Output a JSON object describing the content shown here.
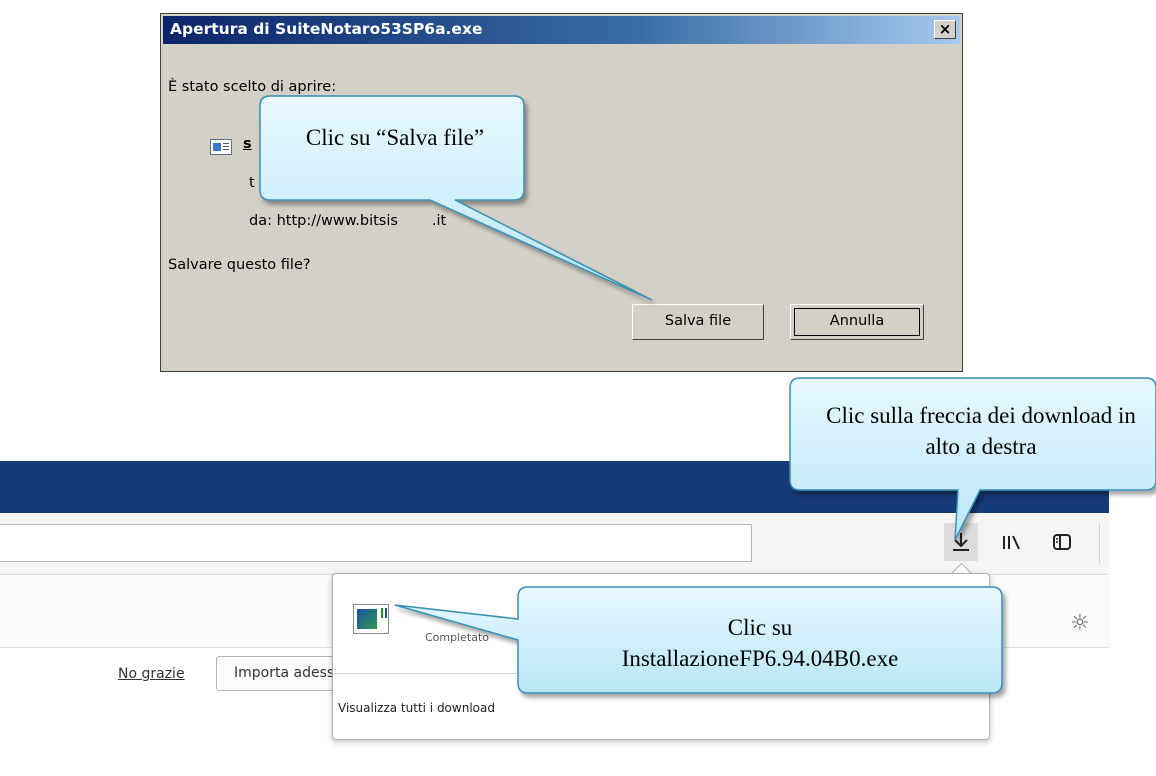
{
  "dialog": {
    "title": "Apertura di SuiteNotaro53SP6a.exe",
    "close_glyph": "×",
    "chosen_label": "È stato scelto di aprire:",
    "file_name_fragment": "s",
    "type_fragment": "t",
    "source_label": "da:  http://www.bitsis",
    "source_tail": ".it",
    "question": "Salvare questo file?",
    "save_button": "Salva file",
    "cancel_button": "Annulla"
  },
  "browser": {
    "library_icon_glyph": "\\",
    "gear_glyph": "☼",
    "infobar": {
      "no_thanks": "No grazie",
      "import_now": "Importa adesso"
    }
  },
  "downloads_panel": {
    "status": "Completato",
    "show_all": "Visualizza tutti i download"
  },
  "callouts": {
    "save_file": "Clic su “Salva file”",
    "download_arrow": "Clic sulla freccia dei download in alto a destra",
    "installer_prefix": "Clic su",
    "installer_name": "InstallazioneFP6.94.04B0.exe"
  },
  "colors": {
    "dialog_face": "#d4d0c8",
    "title_bar": "#0a246a",
    "browser_header": "#173a78",
    "callout_fill": "#c6eefc",
    "callout_border": "#3a8fb7"
  }
}
